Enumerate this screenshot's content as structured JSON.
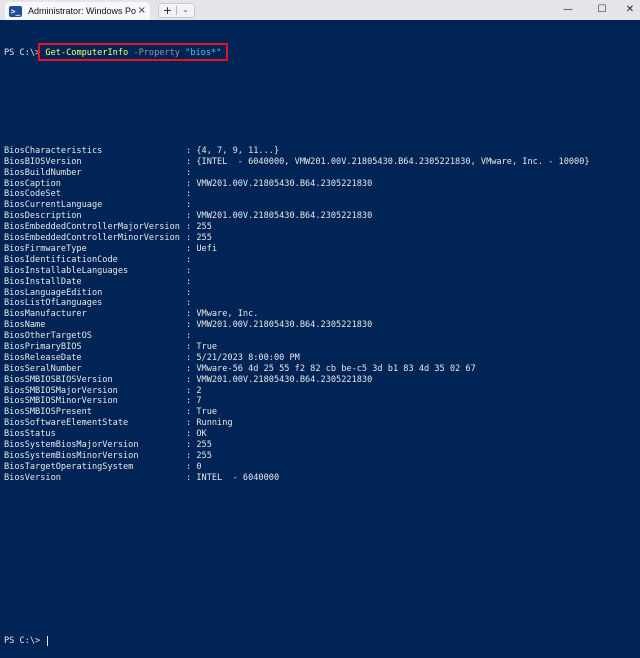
{
  "window": {
    "tab_title": "Administrator: Windows PowerShell",
    "tab_icon": "powershell-icon",
    "new_tab": "+",
    "dropdown": "⌄",
    "close_tab": "×",
    "minimize": "—",
    "maximize": "☐",
    "close": "✕"
  },
  "terminal": {
    "prompt": "PS C:\\> ",
    "command": {
      "cmdlet": "Get-ComputerInfo",
      "param": "-Property",
      "arg": "\"bios*\""
    },
    "highlight_color": "#e81123",
    "background": "#012456",
    "properties": [
      {
        "name": "BiosCharacteristics",
        "value": ": {4, 7, 9, 11...}"
      },
      {
        "name": "BiosBIOSVersion",
        "value": ": {INTEL  - 6040000, VMW201.00V.21805430.B64.2305221830, VMware, Inc. - 10000}"
      },
      {
        "name": "BiosBuildNumber",
        "value": ":"
      },
      {
        "name": "BiosCaption",
        "value": ": VMW201.00V.21805430.B64.2305221830"
      },
      {
        "name": "BiosCodeSet",
        "value": ":"
      },
      {
        "name": "BiosCurrentLanguage",
        "value": ":"
      },
      {
        "name": "BiosDescription",
        "value": ": VMW201.00V.21805430.B64.2305221830"
      },
      {
        "name": "BiosEmbeddedControllerMajorVersion",
        "value": ": 255"
      },
      {
        "name": "BiosEmbeddedControllerMinorVersion",
        "value": ": 255"
      },
      {
        "name": "BiosFirmwareType",
        "value": ": Uefi"
      },
      {
        "name": "BiosIdentificationCode",
        "value": ":"
      },
      {
        "name": "BiosInstallableLanguages",
        "value": ":"
      },
      {
        "name": "BiosInstallDate",
        "value": ":"
      },
      {
        "name": "BiosLanguageEdition",
        "value": ":"
      },
      {
        "name": "BiosListOfLanguages",
        "value": ":"
      },
      {
        "name": "BiosManufacturer",
        "value": ": VMware, Inc."
      },
      {
        "name": "BiosName",
        "value": ": VMW201.00V.21805430.B64.2305221830"
      },
      {
        "name": "BiosOtherTargetOS",
        "value": ":"
      },
      {
        "name": "BiosPrimaryBIOS",
        "value": ": True"
      },
      {
        "name": "BiosReleaseDate",
        "value": ": 5/21/2023 8:00:00 PM"
      },
      {
        "name": "BiosSeralNumber",
        "value": ": VMware-56 4d 25 55 f2 82 cb be-c5 3d b1 83 4d 35 02 67"
      },
      {
        "name": "BiosSMBIOSBIOSVersion",
        "value": ": VMW201.00V.21805430.B64.2305221830"
      },
      {
        "name": "BiosSMBIOSMajorVersion",
        "value": ": 2"
      },
      {
        "name": "BiosSMBIOSMinorVersion",
        "value": ": 7"
      },
      {
        "name": "BiosSMBIOSPresent",
        "value": ": True"
      },
      {
        "name": "BiosSoftwareElementState",
        "value": ": Running"
      },
      {
        "name": "BiosStatus",
        "value": ": OK"
      },
      {
        "name": "BiosSystemBiosMajorVersion",
        "value": ": 255"
      },
      {
        "name": "BiosSystemBiosMinorVersion",
        "value": ": 255"
      },
      {
        "name": "BiosTargetOperatingSystem",
        "value": ": 0"
      },
      {
        "name": "BiosVersion",
        "value": ": INTEL  - 6040000"
      }
    ],
    "final_prompt": "PS C:\\> "
  }
}
